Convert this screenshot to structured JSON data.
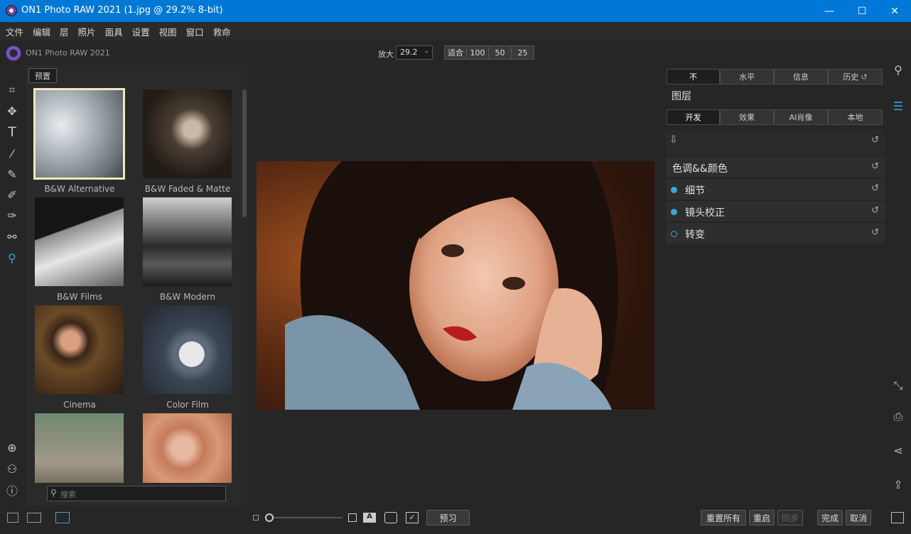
{
  "window": {
    "title": "ON1 Photo RAW 2021 (1.jpg @ 29.2% 8-bit)",
    "minimize": "—",
    "maximize": "☐",
    "close": "✕"
  },
  "menu": [
    "文件",
    "编辑",
    "层",
    "照片",
    "面具",
    "设置",
    "视图",
    "窗口",
    "救命"
  ],
  "app": {
    "name": "ON1 Photo RAW 2021",
    "logo_text": "ON1"
  },
  "zoom": {
    "label": "放大",
    "value": "29.2",
    "presets": [
      "适合",
      "100",
      "50",
      "25"
    ]
  },
  "browser": {
    "preset_button": "预置",
    "search_placeholder": "搜索",
    "presets": [
      {
        "name": "B&W Alternative",
        "icon": "capital-photo",
        "selected": true
      },
      {
        "name": "B&W Faded & Matte",
        "icon": "portrait-photo"
      },
      {
        "name": "B&W Films",
        "icon": "bridge-photo"
      },
      {
        "name": "B&W Modern",
        "icon": "waterfall-photo"
      },
      {
        "name": "Cinema",
        "icon": "woman-photo"
      },
      {
        "name": "Color Film",
        "icon": "scale-photo"
      },
      {
        "name": "",
        "icon": "ruins-photo"
      },
      {
        "name": "",
        "icon": "hat-woman-photo"
      }
    ]
  },
  "bottom": {
    "preview": "预习",
    "reset_all": "重置所有",
    "restart": "重启",
    "sync": "同步",
    "done": "完成",
    "cancel": "取消"
  },
  "right_panel": {
    "top_tabs": [
      "不",
      "水平",
      "信息",
      "历史"
    ],
    "layers_label": "图层",
    "module_tabs": [
      "开发",
      "效果",
      "AI肖像",
      "本地"
    ],
    "sections": [
      {
        "label": "色调&&颜色",
        "marker": "none"
      },
      {
        "label": "细节",
        "marker": "filled"
      },
      {
        "label": "镜头校正",
        "marker": "filled"
      },
      {
        "label": "转变",
        "marker": "hollow"
      }
    ]
  },
  "colors": {
    "titlebar": "#0078d7",
    "accent": "#3aa7d8",
    "background": "#262626"
  }
}
